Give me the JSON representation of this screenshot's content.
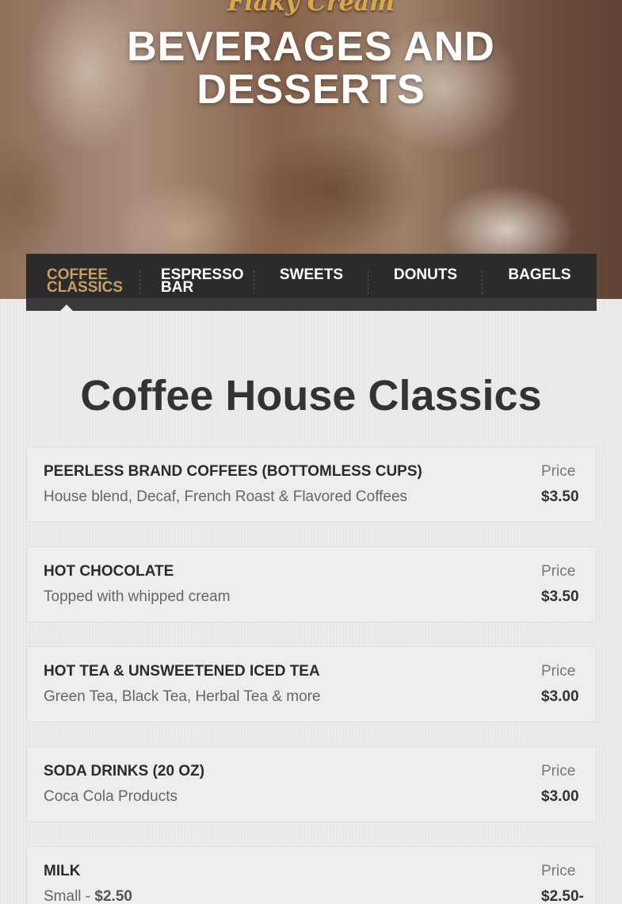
{
  "hero": {
    "script_title": "Flaky Cream",
    "title_line1": "BEVERAGES AND",
    "title_line2": "DESSERTS"
  },
  "tabs": [
    {
      "line1": "COFFEE",
      "line2": "CLASSICS",
      "active": true
    },
    {
      "line1": "ESPRESSO",
      "line2": "BAR",
      "active": false
    },
    {
      "line1": "SWEETS",
      "line2": "",
      "active": false
    },
    {
      "line1": "DONUTS",
      "line2": "",
      "active": false
    },
    {
      "line1": "BAGELS",
      "line2": "",
      "active": false
    }
  ],
  "section_title": "Coffee House Classics",
  "items": [
    {
      "name": "PEERLESS BRAND COFFEES (BOTTOMLESS CUPS)",
      "description": "House blend, Decaf, French Roast & Flavored Coffees",
      "price_label": "Price",
      "price": "$3.50"
    },
    {
      "name": "HOT CHOCOLATE",
      "description": "Topped with whipped cream",
      "price_label": "Price",
      "price": "$3.50"
    },
    {
      "name": "HOT TEA & UNSWEETENED ICED TEA",
      "description": "Green Tea, Black Tea, Herbal Tea & more",
      "price_label": "Price",
      "price": "$3.00"
    },
    {
      "name": "SODA DRINKS (20 OZ)",
      "description": "Coca Cola Products",
      "price_label": "Price",
      "price": "$3.00"
    },
    {
      "name": "MILK",
      "description_prefix": "Small - ",
      "description_price": "$2.50",
      "price_label": "Price",
      "price": "$2.50-"
    }
  ],
  "colors": {
    "accent": "#c9a063",
    "script_gold": "#d9a84d",
    "tabbar_bg": "#2b2b2b",
    "page_bg": "#ebebeb",
    "heading": "#333333"
  }
}
